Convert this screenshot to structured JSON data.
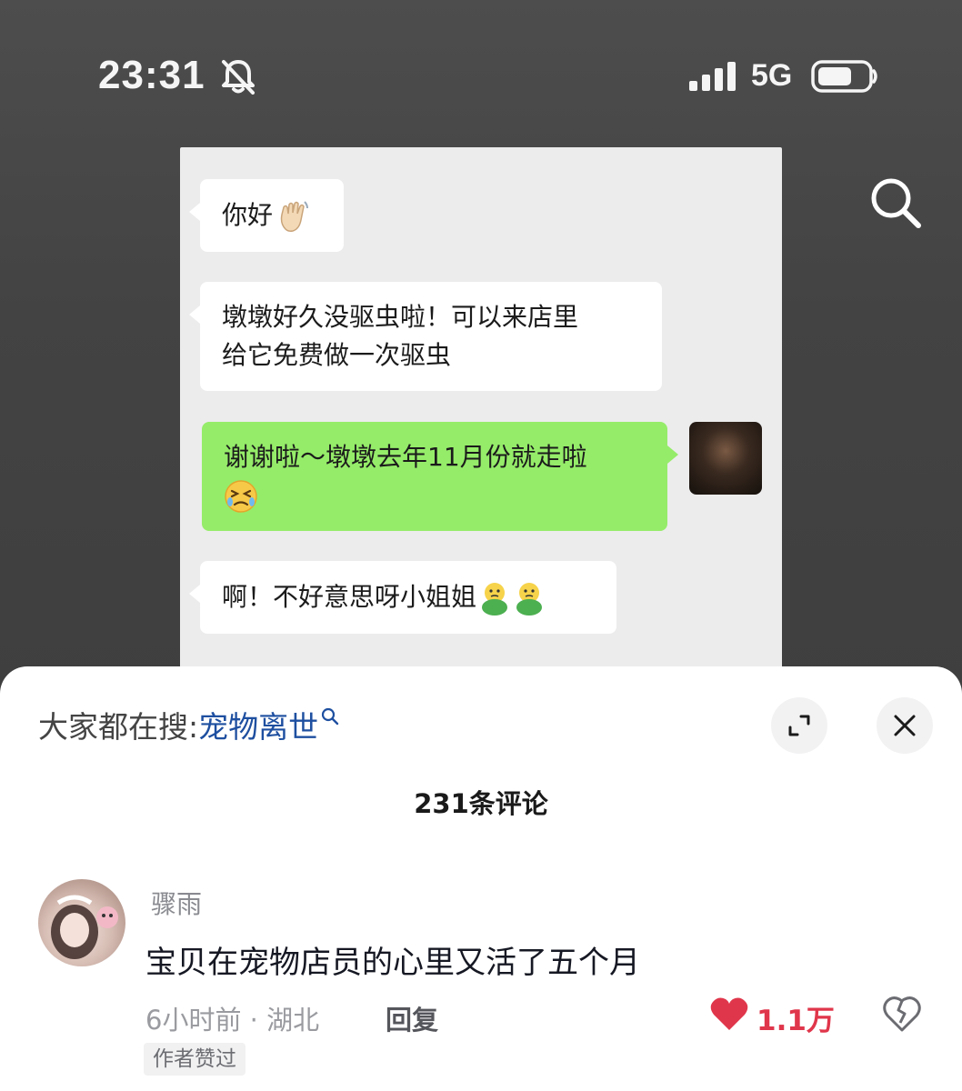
{
  "status_bar": {
    "time": "23:31",
    "network": "5G",
    "icons": [
      "bell-muted-icon",
      "signal-bars-icon",
      "battery-icon"
    ]
  },
  "video": {
    "search_icon": "search-icon",
    "chat": {
      "messages": [
        {
          "side": "left",
          "text": "你好",
          "emoji": "waving-hand"
        },
        {
          "side": "left",
          "text": "墩墩好久没驱虫啦！可以来店里",
          "text2": "给它免费做一次驱虫"
        },
        {
          "side": "right",
          "text": "谢谢啦～墩墩去年11月份就走啦",
          "emoji": "crying-face"
        },
        {
          "side": "left",
          "text": "啊！不好意思呀小姐姐",
          "emoji": "two-duck-emojis"
        }
      ]
    }
  },
  "comments_sheet": {
    "trending_prefix": "大家都在搜:",
    "trending_keyword": "宠物离世",
    "expand_icon": "expand-icon",
    "close_icon": "close-icon",
    "comment_count_label": "231条评论",
    "comments": [
      {
        "username": "骤雨",
        "text": "宝贝在宠物店员的心里又活了五个月",
        "meta": "6小时前 · 湖北",
        "reply_label": "回复",
        "likes": "1.1万",
        "badge": "作者赞过"
      }
    ],
    "colors": {
      "like": "#e0364b",
      "keyword": "#1e4fa0",
      "chat_green": "#95ec69"
    }
  }
}
